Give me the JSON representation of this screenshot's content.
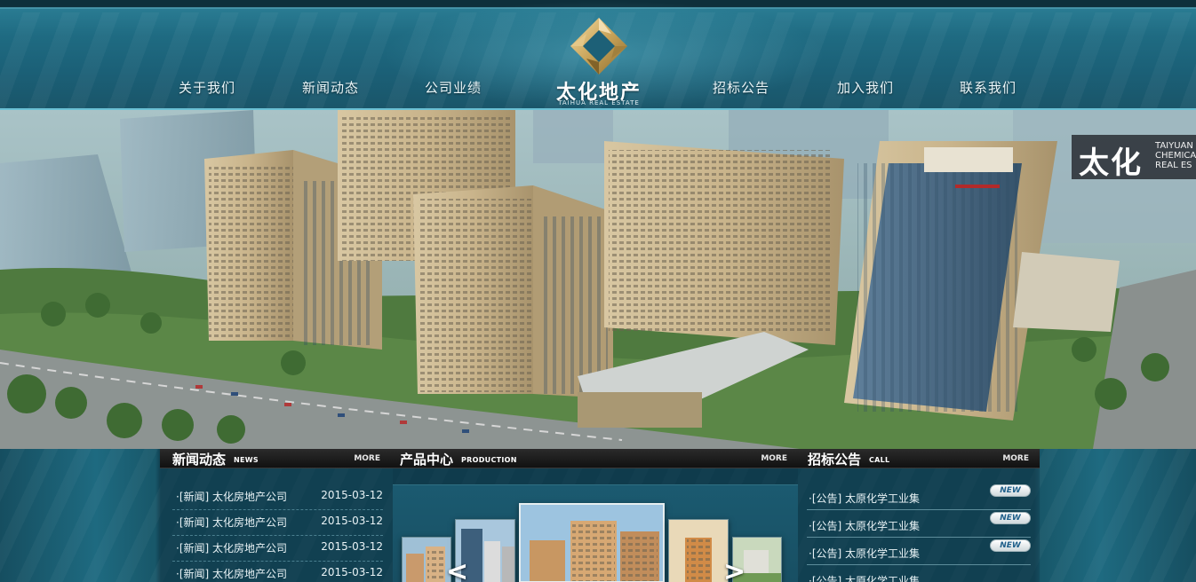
{
  "nav": {
    "items": [
      {
        "label": "关于我们"
      },
      {
        "label": "新闻动态"
      },
      {
        "label": "公司业绩"
      },
      {
        "label": "招标公告"
      },
      {
        "label": "加入我们"
      },
      {
        "label": "联系我们"
      }
    ]
  },
  "logo": {
    "name": "太化地产",
    "sub": "TAIHUA REAL ESTATE",
    "icon": "diamond-logo-icon"
  },
  "hero": {
    "badge_big": "太化",
    "badge_line1": "TAIYUAN",
    "badge_line2": "CHEMICA",
    "badge_line3": "REAL ES"
  },
  "news": {
    "title": "新闻动态",
    "sub": "NEWS",
    "more": "MORE",
    "items": [
      {
        "text": "·[新闻] 太化房地产公司",
        "date": "2015-03-12"
      },
      {
        "text": "·[新闻] 太化房地产公司",
        "date": "2015-03-12"
      },
      {
        "text": "·[新闻] 太化房地产公司",
        "date": "2015-03-12"
      },
      {
        "text": "·[新闻] 太化房地产公司",
        "date": "2015-03-12"
      }
    ]
  },
  "production": {
    "title": "产品中心",
    "sub": "PRODUCTION",
    "more": "MORE",
    "prev": "<",
    "next": ">"
  },
  "call": {
    "title": "招标公告",
    "sub": "CALL",
    "more": "MORE",
    "badge": "NEW",
    "items": [
      {
        "text": "·[公告] 太原化学工业集"
      },
      {
        "text": "·[公告] 太原化学工业集"
      },
      {
        "text": "·[公告] 太原化学工业集"
      },
      {
        "text": "·[公告] 太原化学工业集"
      }
    ]
  },
  "colors": {
    "header": "#1f6b82",
    "accent": "#6bc0d4",
    "logo_gold": "#c9a45a",
    "panel": "#0f3a4a"
  }
}
